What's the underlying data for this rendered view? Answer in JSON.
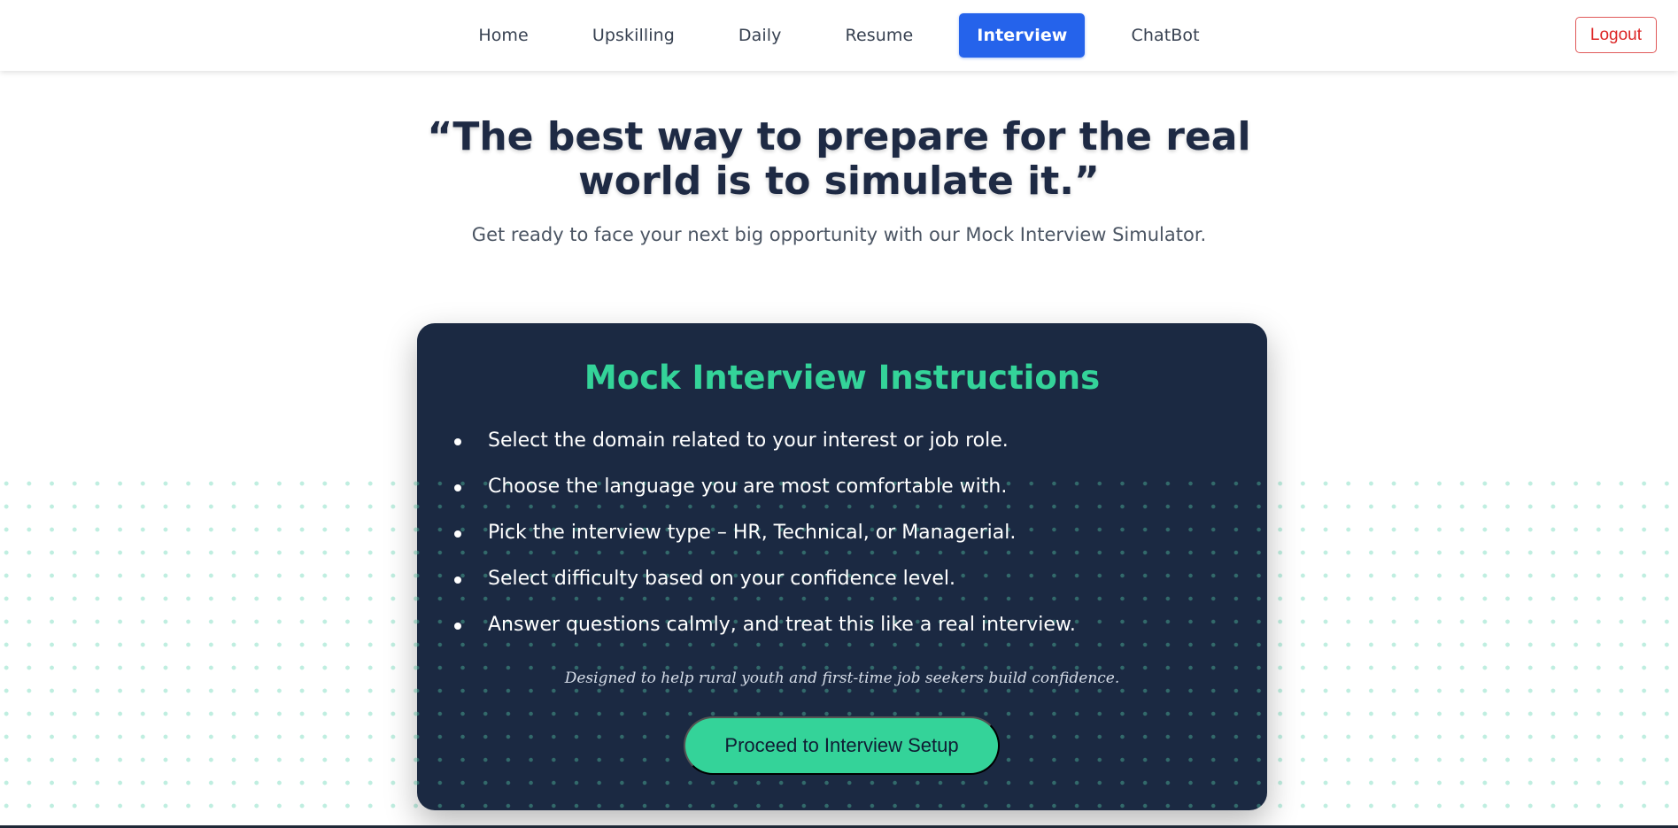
{
  "nav": {
    "items": [
      {
        "label": "Home"
      },
      {
        "label": "Upskilling"
      },
      {
        "label": "Daily"
      },
      {
        "label": "Resume"
      },
      {
        "label": "Interview",
        "active": true
      },
      {
        "label": "ChatBot"
      }
    ],
    "logout_label": "Logout"
  },
  "hero": {
    "quote_line1": "“The best way to prepare for the real",
    "quote_line2": "world is to simulate it.”",
    "subtitle": "Get ready to face your next big opportunity with our Mock Interview Simulator."
  },
  "card": {
    "title": "Mock Interview Instructions",
    "instructions": [
      "Select the domain related to your interest or job role.",
      "Choose the language you are most comfortable with.",
      "Pick the interview type – HR, Technical, or Managerial.",
      "Select difficulty based on your confidence level.",
      "Answer questions calmly, and treat this like a real interview."
    ],
    "note": "Designed to help rural youth and first-time job seekers build confidence.",
    "proceed_label": "Proceed to Interview Setup"
  },
  "colors": {
    "accent": "#2563eb",
    "card_bg": "#1b2942",
    "title_green": "#34d399",
    "logout_red": "#dc2626"
  }
}
